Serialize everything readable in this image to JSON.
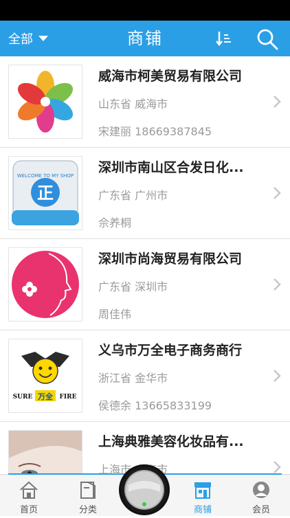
{
  "header": {
    "filter_label": "全部",
    "title": "商铺"
  },
  "shops": [
    {
      "name": "威海市柯美贸易有限公司",
      "location": "山东省 威海市",
      "contact": "宋建丽 18669387845"
    },
    {
      "name": "深圳市南山区合发日化...",
      "location": "广东省 广州市",
      "contact": "佘养桐",
      "logo_text": "WELCOME TO MY SHOP",
      "logo_char": "正"
    },
    {
      "name": "深圳市尚海贸易有限公司",
      "location": "广东省 深圳市",
      "contact": "周佳伟"
    },
    {
      "name": "义乌市万全电子商务商行",
      "location": "浙江省 金华市",
      "contact": "侯德余 13665833199",
      "logo_left": "SURE",
      "logo_mid": "万全",
      "logo_right": "FIRE"
    },
    {
      "name": "上海典雅美容化妆品有...",
      "location": "上海市 上海市",
      "contact": ""
    }
  ],
  "tabbar": {
    "home": "首页",
    "category": "分类",
    "shops": "商铺",
    "member": "会员"
  }
}
